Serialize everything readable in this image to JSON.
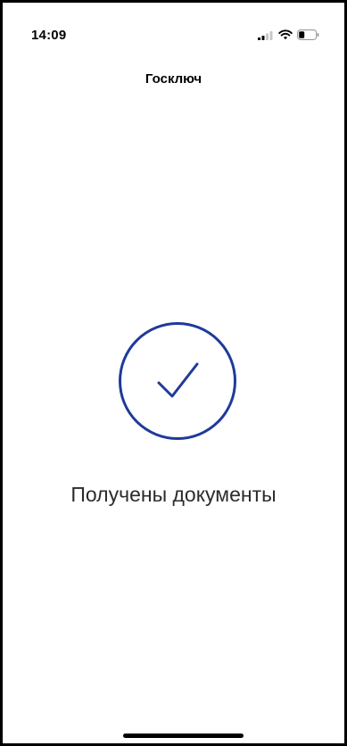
{
  "status_bar": {
    "time": "14:09",
    "icons": [
      "cellular-signal-icon",
      "wifi-icon",
      "battery-icon"
    ]
  },
  "header": {
    "title": "Госключ"
  },
  "main": {
    "success_icon": "checkmark-circle-icon",
    "message": "Получены документы"
  },
  "colors": {
    "accent": "#1f3a9a",
    "background": "#ffffff",
    "text": "#2b2b2b"
  }
}
